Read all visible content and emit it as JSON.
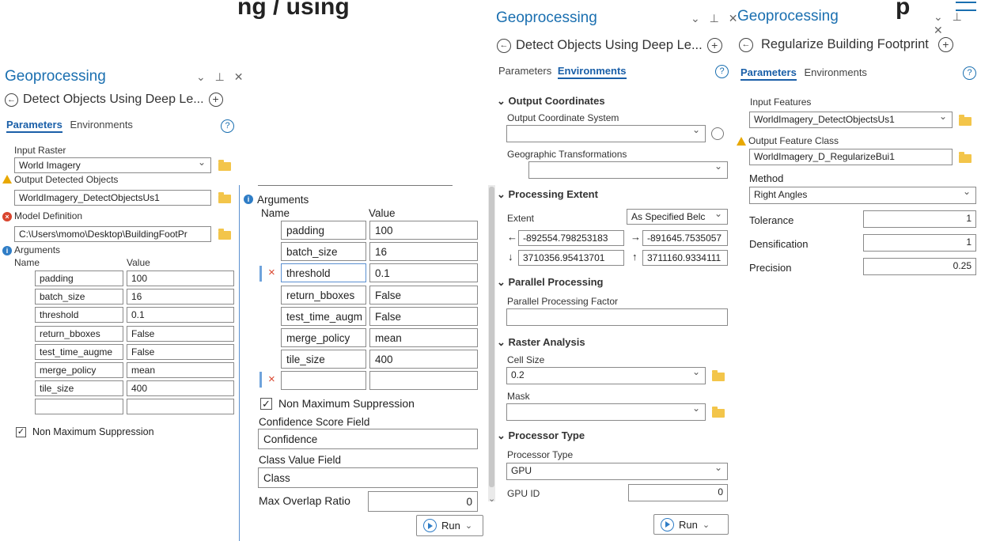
{
  "top_banner": "ng / using",
  "panel_title": "Geoprocessing",
  "panel1": {
    "tool": "Detect Objects Using Deep Le...",
    "tab_params": "Parameters",
    "tab_env": "Environments",
    "input_raster_label": "Input Raster",
    "input_raster_value": "World Imagery",
    "output_label": "Output Detected Objects",
    "output_value": "WorldImagery_DetectObjectsUs1",
    "model_label": "Model Definition",
    "model_value": "C:\\Users\\momo\\Desktop\\BuildingFootPr",
    "args_label": "Arguments",
    "col_name": "Name",
    "col_value": "Value",
    "args": [
      {
        "name": "padding",
        "value": "100"
      },
      {
        "name": "batch_size",
        "value": "16"
      },
      {
        "name": "threshold",
        "value": "0.1"
      },
      {
        "name": "return_bboxes",
        "value": "False"
      },
      {
        "name": "test_time_augme",
        "value": "False"
      },
      {
        "name": "merge_policy",
        "value": "mean"
      },
      {
        "name": "tile_size",
        "value": "400"
      },
      {
        "name": "",
        "value": ""
      }
    ],
    "nms_label": "Non Maximum Suppression"
  },
  "panel2": {
    "args_label": "Arguments",
    "col_name": "Name",
    "col_value": "Value",
    "args": [
      {
        "name": "padding",
        "value": "100"
      },
      {
        "name": "batch_size",
        "value": "16"
      },
      {
        "name": "threshold",
        "value": "0.1"
      },
      {
        "name": "return_bboxes",
        "value": "False"
      },
      {
        "name": "test_time_augm",
        "value": "False"
      },
      {
        "name": "merge_policy",
        "value": "mean"
      },
      {
        "name": "tile_size",
        "value": "400"
      },
      {
        "name": "",
        "value": ""
      }
    ],
    "nms_label": "Non Maximum Suppression",
    "conf_label": "Confidence Score Field",
    "conf_value": "Confidence",
    "class_label": "Class Value Field",
    "class_value": "Class",
    "overlap_label": "Max Overlap Ratio",
    "overlap_value": "0",
    "run_label": "Run"
  },
  "panel3": {
    "tool": "Detect Objects Using Deep Le...",
    "tab_params": "Parameters",
    "tab_env": "Environments",
    "sec_coords": "Output Coordinates",
    "ocs_label": "Output Coordinate System",
    "geo_label": "Geographic Transformations",
    "sec_extent": "Processing Extent",
    "extent_label": "Extent",
    "extent_value": "As Specified Belc",
    "left": "-892554.798253183",
    "right": "-891645.7535057",
    "bottom": "3710356.95413701",
    "top": "3711160.9334111",
    "sec_parallel": "Parallel Processing",
    "ppf_label": "Parallel Processing Factor",
    "sec_raster": "Raster Analysis",
    "cell_label": "Cell Size",
    "cell_value": "0.2",
    "mask_label": "Mask",
    "sec_proc": "Processor Type",
    "proc_label": "Processor Type",
    "proc_value": "GPU",
    "gpu_label": "GPU ID",
    "gpu_value": "0",
    "run_label": "Run"
  },
  "panel4": {
    "tool": "Regularize Building Footprint",
    "tab_params": "Parameters",
    "tab_env": "Environments",
    "in_label": "Input Features",
    "in_value": "WorldImagery_DetectObjectsUs1",
    "out_label": "Output Feature Class",
    "out_value": "WorldImagery_D_RegularizeBui1",
    "method_label": "Method",
    "method_value": "Right Angles",
    "tol_label": "Tolerance",
    "tol_value": "1",
    "dens_label": "Densification",
    "dens_value": "1",
    "prec_label": "Precision",
    "prec_value": "0.25"
  }
}
